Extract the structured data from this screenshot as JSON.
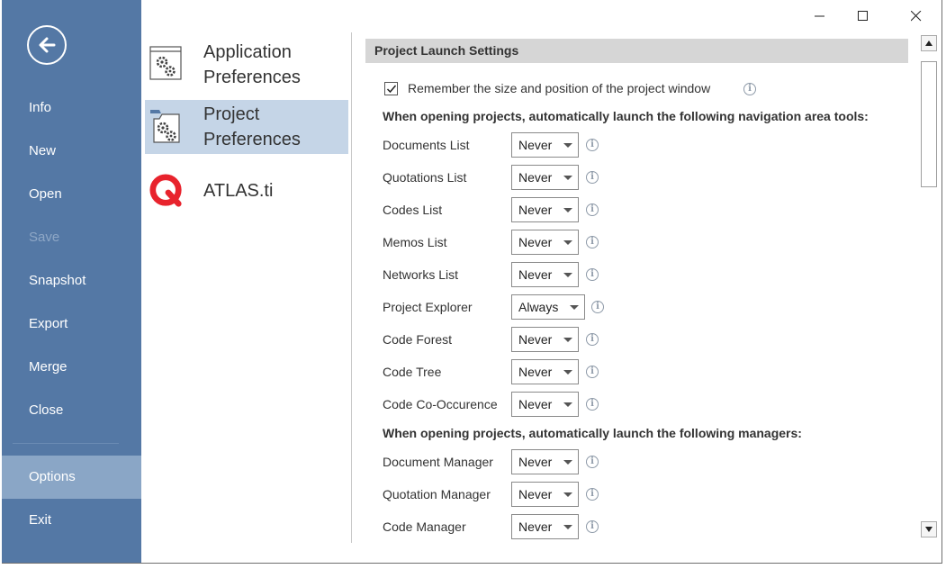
{
  "backstage": {
    "items": [
      {
        "label": "Info"
      },
      {
        "label": "New"
      },
      {
        "label": "Open"
      },
      {
        "label": "Save"
      },
      {
        "label": "Snapshot"
      },
      {
        "label": "Export"
      },
      {
        "label": "Merge"
      },
      {
        "label": "Close"
      },
      {
        "label": "Options"
      },
      {
        "label": "Exit"
      }
    ],
    "selected": "Options",
    "disabled": [
      "Save"
    ],
    "accent_color": "#5478a5",
    "selected_color": "#8aa6c6"
  },
  "categories": [
    {
      "line1": "Application",
      "line2": "Preferences",
      "icon": "gears-icon"
    },
    {
      "line1": "Project",
      "line2": "Preferences",
      "icon": "project-gears-icon"
    },
    {
      "line1": "ATLAS.ti",
      "line2": "",
      "icon": "atlas-ti-logo"
    }
  ],
  "settings": {
    "section_title": "Project Launch Settings",
    "remember_label": "Remember the size and position of the project window",
    "remember_checked": true,
    "nav_heading": "When opening projects, automatically launch the following navigation area tools:",
    "nav_tools": [
      {
        "label": "Documents List",
        "value": "Never"
      },
      {
        "label": "Quotations List",
        "value": "Never"
      },
      {
        "label": "Codes List",
        "value": "Never"
      },
      {
        "label": "Memos List",
        "value": "Never"
      },
      {
        "label": "Networks List",
        "value": "Never"
      },
      {
        "label": "Project Explorer",
        "value": "Always"
      },
      {
        "label": "Code Forest",
        "value": "Never"
      },
      {
        "label": "Code Tree",
        "value": "Never"
      },
      {
        "label": "Code Co-Occurence",
        "value": "Never"
      }
    ],
    "managers_heading": "When opening projects, automatically launch the following managers:",
    "managers": [
      {
        "label": "Document Manager",
        "value": "Never"
      },
      {
        "label": "Quotation Manager",
        "value": "Never"
      },
      {
        "label": "Code Manager",
        "value": "Never"
      }
    ]
  }
}
